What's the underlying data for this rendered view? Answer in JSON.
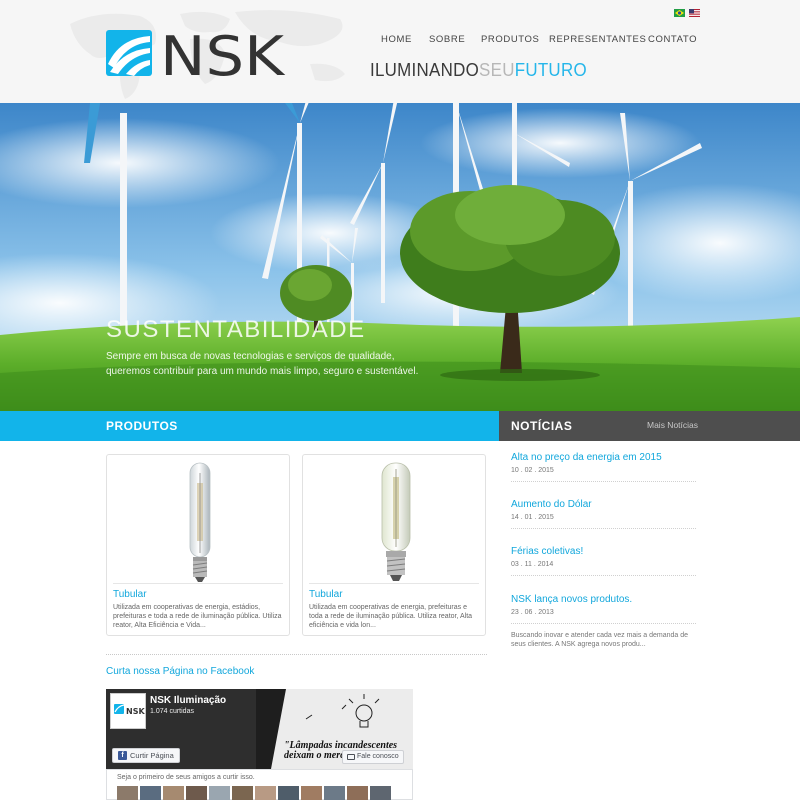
{
  "header": {
    "logo_text": "NSK",
    "tagline": {
      "part1": "ILUMINANDO",
      "part2": "SEU",
      "part3": "FUTURO"
    },
    "flags": [
      "brazil-flag",
      "usa-flag"
    ]
  },
  "nav": {
    "items": [
      {
        "label": "HOME"
      },
      {
        "label": "SOBRE"
      },
      {
        "label": "PRODUTOS"
      },
      {
        "label": "REPRESENTANTES"
      },
      {
        "label": "CONTATO"
      }
    ]
  },
  "hero": {
    "title": "SUSTENTABILIDADE",
    "description": "Sempre em busca de novas tecnologias e serviços de qualidade, queremos contribuir para um mundo mais limpo, seguro e sustentável."
  },
  "products_section": {
    "title": "PRODUTOS"
  },
  "products": [
    {
      "title": "Tubular",
      "description": "Utilizada em cooperativas de energia, estádios, prefeituras e toda a rede de iluminação pública. Utiliza reator, Alta Eficiência e Vida..."
    },
    {
      "title": "Tubular",
      "description": "Utilizada em cooperativas de energia, prefeituras e toda a rede de iluminação pública.   Utiliza reator, Alta eficiência e vida lon..."
    }
  ],
  "news_section": {
    "title": "NOTÍCIAS",
    "more_link": "Mais Notícias"
  },
  "news": [
    {
      "title": "Alta no preço da energia em 2015",
      "date": "10 . 02 . 2015"
    },
    {
      "title": "Aumento do Dólar",
      "date": "14 . 01 . 2015"
    },
    {
      "title": "Férias coletivas!",
      "date": "03 . 11 . 2014"
    },
    {
      "title": "NSK lança novos produtos.",
      "date": "23 . 06 . 2013",
      "snippet": "Buscando inovar e atender cada vez mais a demanda de seus clientes. A NSK agrega novos produ..."
    }
  ],
  "facebook": {
    "heading": "Curta nossa Página no Facebook",
    "page_name": "NSK Iluminação",
    "likes": "1.074 curtidas",
    "cover_text": "\"Lâmpadas incandescentes deixam o mercado nacional\"",
    "like_button": "Curtir Página",
    "message_button": "Fale conosco",
    "avatar_text": "NSK",
    "friends_text": "Seja o primeiro de seus amigos a curtir isso."
  },
  "colors": {
    "accent": "#12b4ea",
    "dark_bar": "#4e4e4e",
    "link": "#12a7dc"
  }
}
